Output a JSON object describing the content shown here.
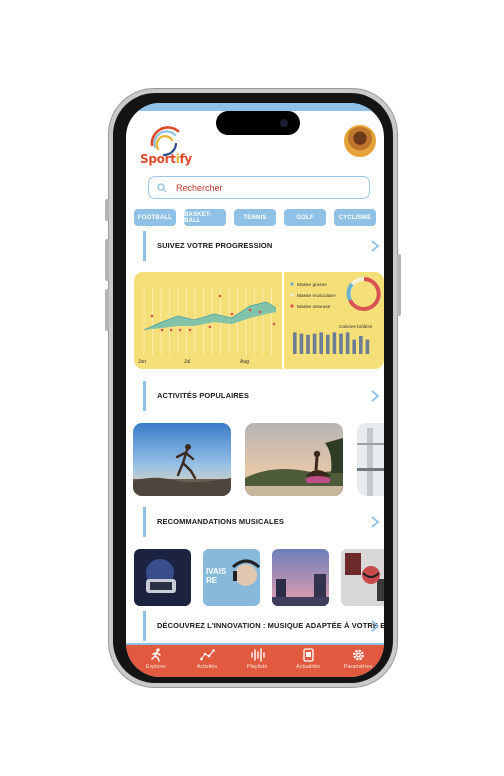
{
  "app": {
    "logo_text_a": "Sport",
    "logo_text_i": "i",
    "logo_text_b": "fy"
  },
  "search": {
    "placeholder": "Rechercher"
  },
  "categories": [
    "FOOTBALL",
    "BASKET-BALL",
    "TENNIS",
    "GOLF",
    "CYCLISME"
  ],
  "sections": {
    "progress": "SUIVEZ VOTRE PROGRESSION",
    "popular": "ACTIVITÉS POPULAIRES",
    "music": "RECOMMANDATIONS MUSICALES",
    "innovation": "DÉCOUVREZ L'INNOVATION : MUSIQUE ADAPTÉE À VOTRE EFFORT"
  },
  "chart_data": {
    "type": "area",
    "x_labels": [
      "Jun",
      "Jul",
      "Aug"
    ],
    "legend": [
      "Masse grasse",
      "Masse musculaire",
      "Masse osseuse"
    ],
    "legend_colors": [
      "#6bb3c8",
      "#f6f0d6",
      "#d9534f"
    ],
    "bar_title": "Calories brûlées",
    "bar_values": [
      9,
      8.5,
      8,
      8.5,
      9,
      8,
      9,
      8.5,
      9,
      6,
      7.5,
      6
    ]
  },
  "music_cards": {
    "card2_text": "IVAIS\nRE"
  },
  "tabs": [
    {
      "label": "Explorer",
      "icon": "runner-icon"
    },
    {
      "label": "Activités",
      "icon": "graph-icon"
    },
    {
      "label": "Playlists",
      "icon": "soundwave-icon"
    },
    {
      "label": "Actualités",
      "icon": "news-icon"
    },
    {
      "label": "Paramètres",
      "icon": "gear-icon"
    }
  ]
}
